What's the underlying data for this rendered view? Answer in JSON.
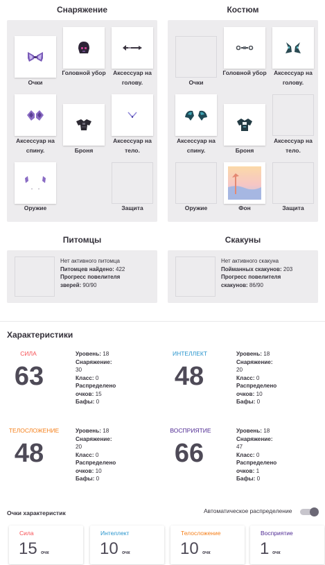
{
  "gear": {
    "title": "Снаряжение",
    "slots": [
      {
        "label": "Очки",
        "icon": "eyewear-item-icon",
        "empty": false
      },
      {
        "label": "Головной убор",
        "icon": "helmet-item-icon",
        "empty": false
      },
      {
        "label": "Аксессуар на голову.",
        "icon": "head-accessory-item-icon",
        "empty": false
      },
      {
        "label": "Аксессуар на спину.",
        "icon": "back-accessory-item-icon",
        "empty": false
      },
      {
        "label": "Броня",
        "icon": "armor-item-icon",
        "empty": false
      },
      {
        "label": "Аксессуар на тело.",
        "icon": "body-accessory-item-icon",
        "empty": false
      },
      {
        "label": "Оружие",
        "icon": "weapon-item-icon",
        "empty": false
      },
      {
        "label": "",
        "icon": "",
        "empty": true
      },
      {
        "label": "Защита",
        "icon": "",
        "empty": true
      }
    ]
  },
  "costume": {
    "title": "Костюм",
    "slots": [
      {
        "label": "Очки",
        "icon": "",
        "empty": true
      },
      {
        "label": "Головной убор",
        "icon": "costume-helmet-item-icon",
        "empty": false
      },
      {
        "label": "Аксессуар на голову.",
        "icon": "costume-head-accessory-item-icon",
        "empty": false
      },
      {
        "label": "Аксессуар на спину.",
        "icon": "costume-wings-item-icon",
        "empty": false
      },
      {
        "label": "Броня",
        "icon": "costume-armor-item-icon",
        "empty": false
      },
      {
        "label": "Аксессуар на тело.",
        "icon": "",
        "empty": true
      },
      {
        "label": "Оружие",
        "icon": "",
        "empty": true
      },
      {
        "label": "Фон",
        "icon": "background-item-icon",
        "empty": false
      },
      {
        "label": "Защита",
        "icon": "",
        "empty": true
      }
    ]
  },
  "pets": {
    "title": "Питомцы",
    "line1": "Нет активного питомца",
    "found_label": "Питомцев найдено:",
    "found_value": "422",
    "progress_label": "Прогресс повелителя",
    "progress_label2": "зверей:",
    "progress_value": "90/90"
  },
  "mounts": {
    "title": "Скакуны",
    "line1": "Нет активного скакуна",
    "found_label": "Пойманных скакунов:",
    "found_value": "203",
    "progress_label": "Прогресс повелителя",
    "progress_label2": "скакунов:",
    "progress_value": "86/90"
  },
  "stats": {
    "title": "Характеристики",
    "level_label": "Уровень:",
    "gear_label": "Снаряжение:",
    "class_label": "Класс:",
    "alloc_label": "Распределено",
    "alloc_label2": "очков:",
    "buffs_label": "Бафы:",
    "items": [
      {
        "name": "СИЛА",
        "color": "#f74e52",
        "total": "63",
        "level": "18",
        "gear": "30",
        "class": "0",
        "alloc": "15",
        "buffs": "0"
      },
      {
        "name": "ИНТЕЛЛЕКТ",
        "color": "#2995cd",
        "total": "48",
        "level": "18",
        "gear": "20",
        "class": "0",
        "alloc": "10",
        "buffs": "0"
      },
      {
        "name": "ТЕЛОСЛОЖЕНИЕ",
        "color": "#f57f19",
        "total": "48",
        "level": "18",
        "gear": "20",
        "class": "0",
        "alloc": "10",
        "buffs": "0"
      },
      {
        "name": "ВОСПРИЯТИЕ",
        "color": "#4f2a93",
        "total": "66",
        "level": "18",
        "gear": "47",
        "class": "0",
        "alloc": "1",
        "buffs": "0"
      }
    ]
  },
  "points": {
    "title": "Очки характеристик",
    "auto_label": "Автоматическое распределение",
    "unit": "очк",
    "cards": [
      {
        "name": "Сила",
        "color": "#f74e52",
        "value": "15"
      },
      {
        "name": "Интеллект",
        "color": "#2995cd",
        "value": "10"
      },
      {
        "name": "Телосложение",
        "color": "#f57f19",
        "value": "10"
      },
      {
        "name": "Восприятие",
        "color": "#4f2a93",
        "value": "1"
      }
    ]
  }
}
